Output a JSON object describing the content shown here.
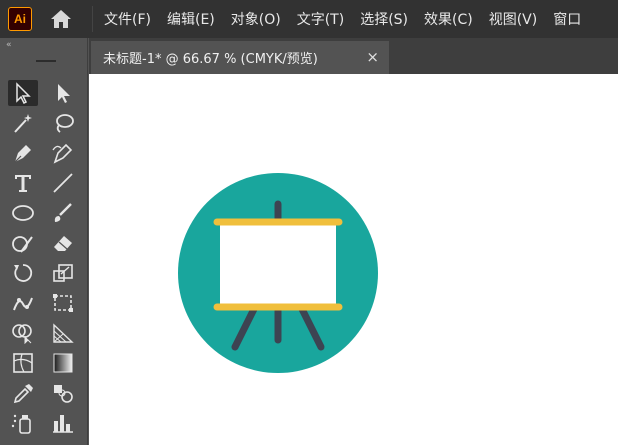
{
  "app": {
    "logo_text": "Ai",
    "logo_color": "#ff9a00",
    "logo_bg": "#330000"
  },
  "menu": {
    "items": [
      {
        "label": "文件(F)"
      },
      {
        "label": "编辑(E)"
      },
      {
        "label": "对象(O)"
      },
      {
        "label": "文字(T)"
      },
      {
        "label": "选择(S)"
      },
      {
        "label": "效果(C)"
      },
      {
        "label": "视图(V)"
      },
      {
        "label": "窗口"
      }
    ]
  },
  "toolbar": {
    "collapse_label": "«",
    "tools": [
      "selection-tool",
      "direct-selection-tool",
      "magic-wand-tool",
      "lasso-tool",
      "pen-tool",
      "curvature-tool",
      "type-tool",
      "line-segment-tool",
      "ellipse-tool",
      "paintbrush-tool",
      "shaper-tool",
      "eraser-tool",
      "rotate-tool",
      "scale-tool",
      "puppet-warp-tool",
      "free-transform-tool",
      "shape-builder-tool",
      "perspective-grid-tool",
      "mesh-tool",
      "gradient-tool",
      "eyedropper-tool",
      "blend-tool",
      "symbol-sprayer-tool",
      "column-graph-tool"
    ]
  },
  "document": {
    "tab_title": "未标题-1* @ 66.67 % (CMYK/预览)",
    "close_label": "×"
  },
  "artwork": {
    "circle_color": "#19a69d",
    "board_color": "#ffffff",
    "rail_color": "#f0bf3c",
    "stand_color": "#3d4452"
  }
}
